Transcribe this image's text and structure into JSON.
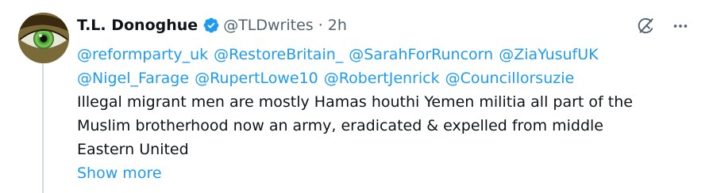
{
  "author": {
    "display_name": "T.L. Donoghue",
    "handle": "@TLDwrites",
    "separator": "·",
    "time": "2h"
  },
  "mentions_line1": [
    "@reformparty_uk",
    "@RestoreBritain_",
    "@SarahForRuncorn",
    "@ZiaYusufUK"
  ],
  "mentions_line2": [
    "@Nigel_Farage",
    "@RupertLowe10",
    "@RobertJenrick",
    "@Councillorsuzie"
  ],
  "text_lines": [
    "Illegal migrant men are mostly Hamas houthi Yemen militia all part of the",
    "Muslim brotherhood now an army, eradicated & expelled from middle",
    "Eastern United"
  ],
  "show_more_label": "Show more",
  "colors": {
    "accent": "#1d9bf0",
    "secondary_text": "#536471",
    "thread_line": "#cfd9de"
  },
  "icons": {
    "verified": "verified-badge-icon",
    "grok": "grok-icon",
    "more": "more-dots-icon"
  }
}
